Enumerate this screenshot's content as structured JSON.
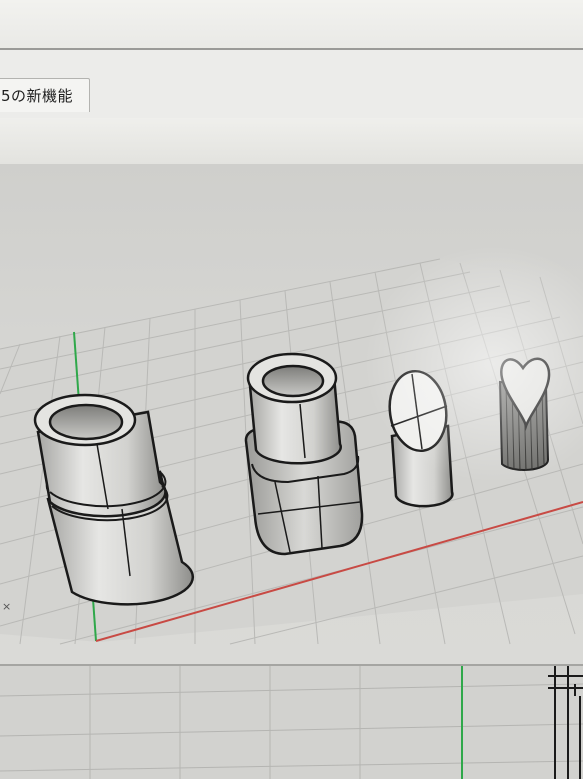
{
  "window": {
    "tab_label": "5の新機能"
  },
  "viewport": {
    "axis_glyph": "×",
    "background_color": "#d6d6d3",
    "grid_color": "#b8b8b5",
    "x_axis_color": "#c84a44",
    "y_axis_color": "#2fa84a",
    "object_fill": "#d8d8d6",
    "object_stroke": "#1a1a1a"
  },
  "objects": [
    {
      "name": "stepped-cylinder"
    },
    {
      "name": "cylinder-on-rounded-box"
    },
    {
      "name": "cylinder-with-oval-cut"
    },
    {
      "name": "cylinder-with-heart-top"
    }
  ]
}
